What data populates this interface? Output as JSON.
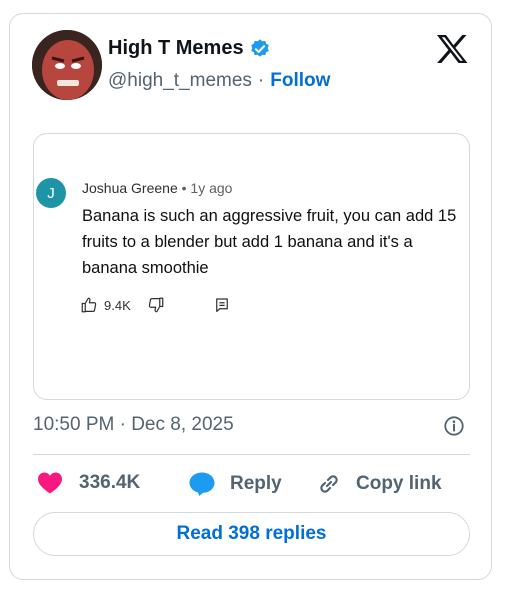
{
  "author": {
    "display_name": "High T Memes",
    "handle": "@high_t_memes",
    "separator": "·",
    "follow_label": "Follow"
  },
  "comment": {
    "avatar_letter": "J",
    "author": "Joshua Greene",
    "meta_separator": "•",
    "age": "1y ago",
    "text": "Banana is such an aggressive fruit, you can add 15 fruits to a blender but add 1 banana and it's a banana smoothie",
    "like_count": "9.4K"
  },
  "timestamp": "10:50 PM · Dec 8, 2025",
  "actions": {
    "likes": "336.4K",
    "reply_label": "Reply",
    "copy_label": "Copy link"
  },
  "read_replies_label": "Read 398 replies",
  "colors": {
    "accent": "#006fd6",
    "verified": "#1d9bf0",
    "heart": "#f91880",
    "reply_bubble": "#1d9bf0",
    "comment_avatar": "#1e95a7"
  }
}
